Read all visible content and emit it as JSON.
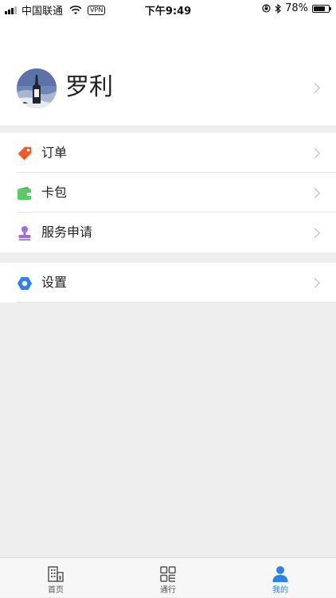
{
  "status_bar": {
    "carrier": "中国联通",
    "vpn": "VPN",
    "time": "下午9:49",
    "battery": "78%",
    "battery_level": 0.78
  },
  "profile": {
    "name": "罗利",
    "avatar_icon": "avatar-photo"
  },
  "menu": {
    "group1": [
      {
        "label": "订单",
        "icon": "tag-icon",
        "color": "#f0592c"
      },
      {
        "label": "卡包",
        "icon": "wallet-icon",
        "color": "#5cc86a"
      },
      {
        "label": "服务申请",
        "icon": "stamp-icon",
        "color": "#9a6fe0"
      }
    ],
    "group2": [
      {
        "label": "设置",
        "icon": "hexagon-settings-icon",
        "color": "#2f80e8"
      }
    ]
  },
  "tabs": [
    {
      "label": "首页",
      "icon": "building-icon",
      "active": false
    },
    {
      "label": "通行",
      "icon": "qr-grid-icon",
      "active": false
    },
    {
      "label": "我的",
      "icon": "user-icon",
      "active": true
    }
  ],
  "colors": {
    "accent": "#2f80e8",
    "background": "#eeeeee"
  }
}
